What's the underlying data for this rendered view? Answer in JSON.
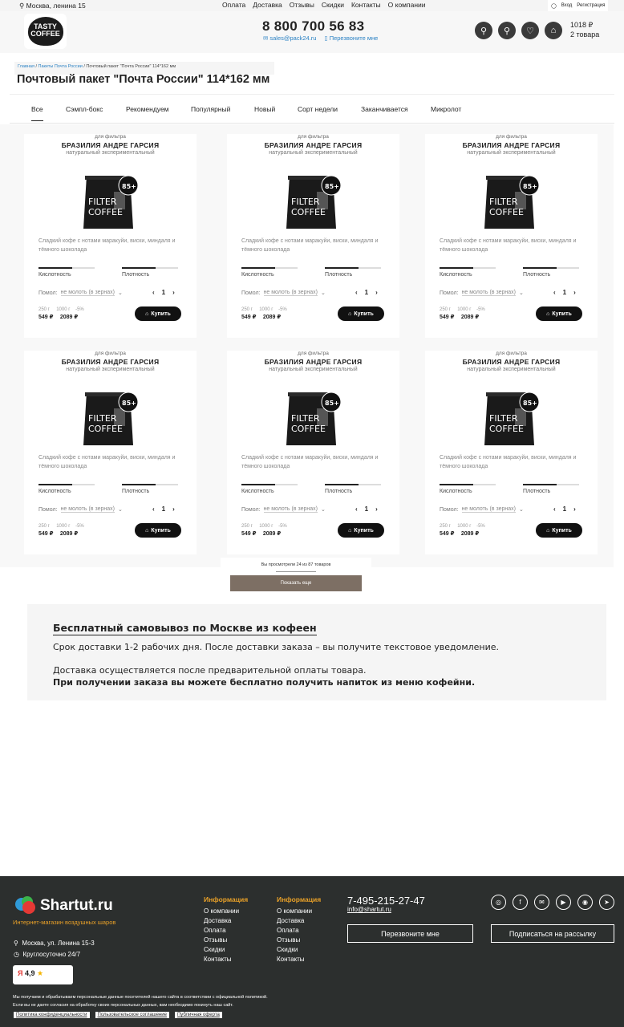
{
  "topbar": {
    "city": "Москва, ленина 15",
    "nav": [
      "Оплата",
      "Доставка",
      "Отзывы",
      "Скидки",
      "Контакты",
      "О компании"
    ],
    "login": "Вход",
    "register": "Регистрация"
  },
  "header": {
    "logo_line1": "TASTY",
    "logo_line2": "COFFEE",
    "phone": "8 800 700 56 83",
    "email": "sales@pack24.ru",
    "callback": "Перезвоните мне",
    "cart_total": "1018 ₽",
    "cart_count": "2 товара"
  },
  "breadcrumb": {
    "home": "Главная",
    "section": "Пакеты Почта России",
    "current": "Почтовый пакет \"Почта России\" 114*162 мм"
  },
  "page_title": "Почтовый пакет \"Почта России\" 114*162 мм",
  "tabs": [
    "Все",
    "Сэмпл-бокс",
    "Рекомендуем",
    "Популярный",
    "Новый",
    "Сорт недели",
    "Заканчивается",
    "Микролот"
  ],
  "product": {
    "for": "для фильтра",
    "name": "БРАЗИЛИЯ АНДРЕ ГАРСИЯ",
    "type": "натуральный экспериментальный",
    "badge": "85+",
    "pack_line1": "FILTER",
    "pack_line2": "COFFEE",
    "desc": "Сладкий кофе с нотами маракуйи, виски, миндаля и тёмного шоколада",
    "acidity_label": "Кислотность",
    "density_label": "Плотность",
    "acidity_level": 0.6,
    "density_level": 0.6,
    "grind_label": "Помол:",
    "grind_value": "не молоть (в зернах)",
    "qty": "1",
    "weight_small": "250 г",
    "weight_big": "1000 г",
    "discount": "-5%",
    "price_small": "549 ₽",
    "price_big": "2089 ₽",
    "buy_label": "Купить"
  },
  "more": {
    "info": "Вы просмотрели 24 из 87 товаров",
    "button": "Показать еще"
  },
  "delivery": {
    "heading": "Бесплатный самовывоз по Москве из кофеен",
    "line1": "Срок доставки 1-2 рабочих дня. После доставки заказа – вы получите текстовое уведомление.",
    "line2": "Доставка осуществляется после предварительной оплаты товара.",
    "line3": "При получении заказа вы можете бесплатно получить напиток из меню кофейни."
  },
  "footer": {
    "brand": "Shartut.ru",
    "tagline": "Интернет-магазин воздушных шаров",
    "address": "Москва, ул. Ленина 15-3",
    "hours": "Круглосуточно 24/7",
    "rating": "4,9",
    "col1_title": "Информация",
    "col2_title": "Информация",
    "links": [
      "О компании",
      "Доставка",
      "Оплата",
      "Отзывы",
      "Скидки",
      "Контакты"
    ],
    "phone": "7-495-215-27-47",
    "email": "info@shartut.ru",
    "callback_btn": "Перезвоните мне",
    "subscribe_btn": "Подписаться на рассылку",
    "legal1": "Мы получаем и обрабатываем персональные данные посетителей нашего сайта в соответствии с официальной политикой.",
    "legal2": "Если вы не даете согласия на обработку своих персональных данных, вам необходимо покинуть наш сайт.",
    "policy": "Политика конфиденциальности",
    "agreement": "Пользовательское соглашение",
    "offer": "Публичная оферта"
  },
  "colors": {
    "accent": "#e8a028",
    "button_more": "#7d6f64",
    "footer_bg": "#2c2f2e",
    "link": "#2b82c4"
  }
}
